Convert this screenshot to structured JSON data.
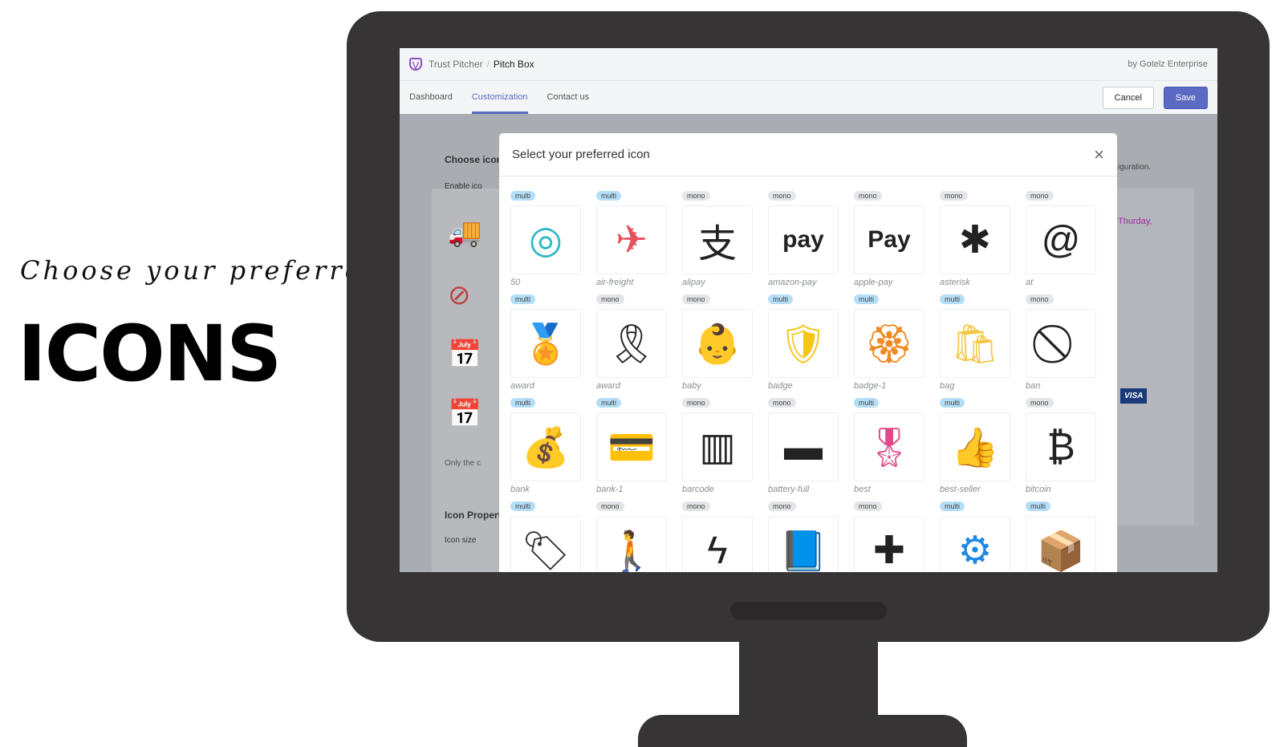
{
  "promo": {
    "line1": "Choose your preferred",
    "line2": "ICONS"
  },
  "app": {
    "brand": "Trust Pitcher",
    "separator": "/",
    "page": "Pitch Box",
    "vendor": "by Gotelz Enterprise",
    "tabs": [
      {
        "label": "Dashboard"
      },
      {
        "label": "Customization",
        "active": true
      },
      {
        "label": "Contact us"
      }
    ],
    "cancel": "Cancel",
    "save": "Save",
    "accent": "#5c6ac4"
  },
  "background": {
    "choose_icon": "Choose icon",
    "enable": "Enable ico",
    "only_note": "Only the c",
    "icon_properties": "Icon Propert",
    "icon_size": "Icon size",
    "config_text": "iguration.",
    "thursday": "Thurday,",
    "visa": "VISA"
  },
  "modal": {
    "title": "Select your preferred icon",
    "close": "×",
    "rows": [
      [
        {
          "tag": "multi",
          "label": "50",
          "icon": "◎",
          "color": "#2eb8c8"
        },
        {
          "tag": "multi",
          "label": "air-freight",
          "icon": "✈",
          "color": "#e8505b"
        },
        {
          "tag": "mono",
          "label": "alipay",
          "icon": "支",
          "color": "#222"
        },
        {
          "tag": "mono",
          "label": "amazon-pay",
          "icon": "pay",
          "color": "#222"
        },
        {
          "tag": "mono",
          "label": "apple-pay",
          "icon": " Pay",
          "color": "#222"
        },
        {
          "tag": "mono",
          "label": "asterisk",
          "icon": "✱",
          "color": "#222"
        },
        {
          "tag": "mono",
          "label": "at",
          "icon": "@",
          "color": "#222"
        }
      ],
      [
        {
          "tag": "multi",
          "label": "award",
          "icon": "🏅",
          "color": "#f5a623"
        },
        {
          "tag": "mono",
          "label": "award",
          "icon": "🎗",
          "color": "#222"
        },
        {
          "tag": "mono",
          "label": "baby",
          "icon": "👶",
          "color": "#222"
        },
        {
          "tag": "multi",
          "label": "badge",
          "icon": "🛡",
          "color": "#f5c518"
        },
        {
          "tag": "multi",
          "label": "badge-1",
          "icon": "🏵",
          "color": "#f08a24"
        },
        {
          "tag": "multi",
          "label": "bag",
          "icon": "🛍",
          "color": "#f5c542"
        },
        {
          "tag": "mono",
          "label": "ban",
          "icon": "⃠",
          "color": "#222"
        }
      ],
      [
        {
          "tag": "multi",
          "label": "bank",
          "icon": "💰",
          "color": "#4caf50"
        },
        {
          "tag": "multi",
          "label": "bank-1",
          "icon": "💳",
          "color": "#2196f3"
        },
        {
          "tag": "mono",
          "label": "barcode",
          "icon": "▥",
          "color": "#222"
        },
        {
          "tag": "mono",
          "label": "battery-full",
          "icon": "▬",
          "color": "#222"
        },
        {
          "tag": "multi",
          "label": "best",
          "icon": "🎖",
          "color": "#e04a8a"
        },
        {
          "tag": "multi",
          "label": "best-seller",
          "icon": "👍",
          "color": "#3a7bd5"
        },
        {
          "tag": "mono",
          "label": "bitcoin",
          "icon": "₿",
          "color": "#222"
        }
      ],
      [
        {
          "tag": "multi",
          "label": "",
          "icon": "🏷",
          "color": "#333"
        },
        {
          "tag": "mono",
          "label": "",
          "icon": "🚶",
          "color": "#222"
        },
        {
          "tag": "mono",
          "label": "",
          "icon": "ϟ",
          "color": "#222"
        },
        {
          "tag": "mono",
          "label": "",
          "icon": "📘",
          "color": "#222"
        },
        {
          "tag": "mono",
          "label": "",
          "icon": "✚",
          "color": "#222"
        },
        {
          "tag": "multi",
          "label": "",
          "icon": "⚙",
          "color": "#1e88e5"
        },
        {
          "tag": "multi",
          "label": "",
          "icon": "📦",
          "color": "#f5b342"
        }
      ]
    ]
  }
}
